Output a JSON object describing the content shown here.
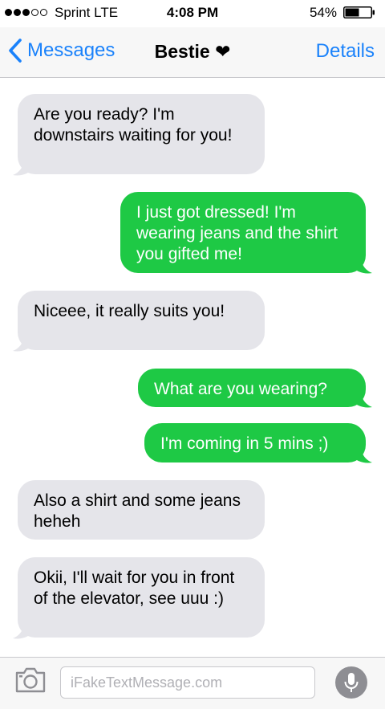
{
  "status_bar": {
    "carrier": "Sprint  LTE",
    "time": "4:08 PM",
    "battery_percent": "54%",
    "signal_bars": 3,
    "signal_total": 5,
    "battery_level": 0.54
  },
  "nav": {
    "back_label": "Messages",
    "title": "Bestie ❤",
    "details_label": "Details"
  },
  "colors": {
    "accent": "#1a82fb",
    "outgoing_bubble": "#1ec945",
    "incoming_bubble": "#e5e5ea"
  },
  "messages": [
    {
      "direction": "incoming",
      "text": "Are you ready? I'm downstairs waiting for you!"
    },
    {
      "direction": "outgoing",
      "text": "I just got dressed! I'm wearing jeans and the shirt you gifted me!"
    },
    {
      "direction": "incoming",
      "text": "Niceee, it really suits you!"
    },
    {
      "direction": "outgoing",
      "text": "What are you wearing?"
    },
    {
      "direction": "outgoing",
      "text": "I'm coming in 5 mins ;)"
    },
    {
      "direction": "incoming",
      "text": "Also a shirt and some jeans heheh"
    },
    {
      "direction": "incoming",
      "text": "Okii, I'll wait for you in front of the elevator, see uuu :)"
    }
  ],
  "input_bar": {
    "placeholder": "iFakeTextMessage.com",
    "camera_icon": "camera-icon",
    "mic_icon": "microphone-icon"
  }
}
